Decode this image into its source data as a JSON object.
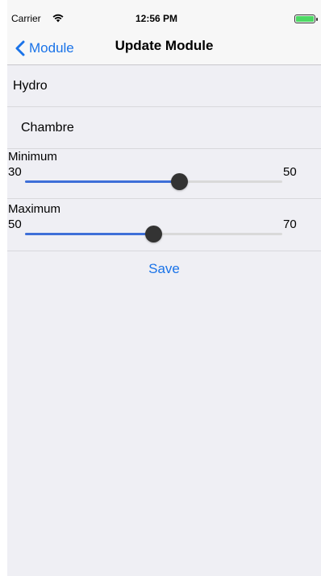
{
  "status_bar": {
    "carrier": "Carrier",
    "time": "12:56 PM",
    "battery_color": "#4cd964"
  },
  "nav": {
    "back_label": "Module",
    "title": "Update Module"
  },
  "cells": {
    "type": "Hydro",
    "room": "Chambre"
  },
  "minimum_slider": {
    "label": "Minimum",
    "min_label": "30",
    "max_label": "50",
    "value": 0.6
  },
  "maximum_slider": {
    "label": "Maximum",
    "min_label": "50",
    "max_label": "70",
    "value": 0.5
  },
  "save_label": "Save",
  "colors": {
    "accent": "#1a73e8",
    "slider_fill": "#3e6fd8",
    "background": "#efeff4"
  }
}
